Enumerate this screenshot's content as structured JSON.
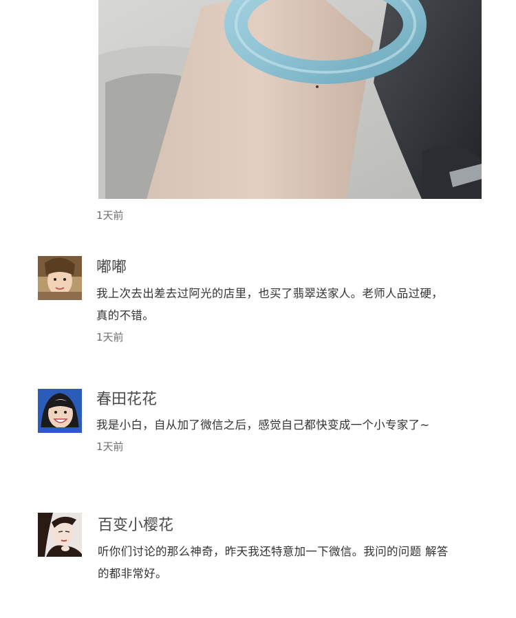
{
  "post": {
    "time": "1天前"
  },
  "comments": [
    {
      "name": "嘟嘟",
      "text_lines": [
        "我上次去出差去过阿光的店里，也买了翡翠送家人。老师人品过硬，",
        "真的不错。"
      ],
      "time": "1天前"
    },
    {
      "name": "春田花花",
      "text_lines": [
        "我是小白，自从加了微信之后，感觉自己都快变成一个小专家了~"
      ],
      "time": "1天前"
    },
    {
      "name": "百变小樱花",
      "text_lines": [
        "听你们讨论的那么神奇，昨天我还特意加一下微信。我问的问题 解答",
        "的都非常好。"
      ]
    }
  ]
}
